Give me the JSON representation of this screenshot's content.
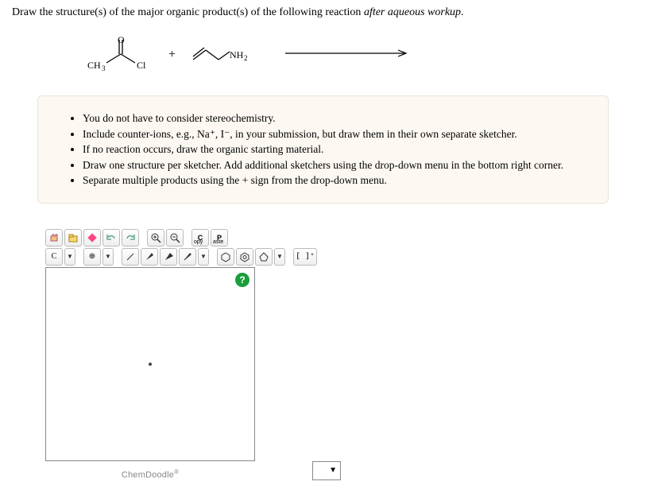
{
  "question": {
    "prefix": "Draw the structure(s) of the major organic product(s) of the following reaction ",
    "italic": "after aqueous workup",
    "suffix": "."
  },
  "reaction": {
    "reactant1": {
      "ch3": "CH",
      "ch3_sub": "3",
      "cl": "Cl"
    },
    "plus": "+",
    "reactant2": {
      "nh2": "NH",
      "nh2_sub": "2"
    }
  },
  "instructions": [
    "You do not have to consider stereochemistry.",
    "Include counter-ions, e.g., Na⁺, I⁻, in your submission, but draw them in their own separate sketcher.",
    "If no reaction occurs, draw the organic starting material.",
    "Draw one structure per sketcher. Add additional sketchers using the drop-down menu in the bottom right corner.",
    "Separate multiple products using the + sign from the drop-down menu."
  ],
  "toolbar": {
    "copy": "opy",
    "copy_c": "C",
    "paste": "aste",
    "paste_p": "P",
    "element_c": "C",
    "charge_plus": "⊕",
    "bracket": "[ ]⁺"
  },
  "canvas": {
    "help": "?",
    "brand": "ChemDoodle",
    "brand_sup": "®",
    "selector": "▼"
  }
}
